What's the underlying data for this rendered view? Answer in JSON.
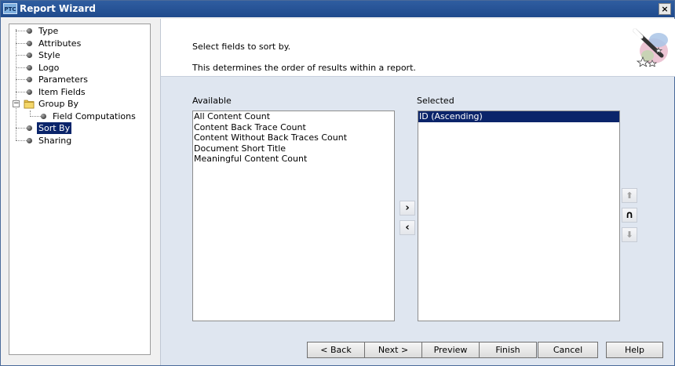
{
  "window": {
    "title": "Report Wizard",
    "logo_text": "PTC",
    "close_label": "×"
  },
  "tree": {
    "items": [
      {
        "label": "Type"
      },
      {
        "label": "Attributes"
      },
      {
        "label": "Style"
      },
      {
        "label": "Logo"
      },
      {
        "label": "Parameters"
      },
      {
        "label": "Item Fields"
      },
      {
        "label": "Group By",
        "expander": "−"
      },
      {
        "label": "Field Computations"
      },
      {
        "label": "Sort By",
        "selected": true
      },
      {
        "label": "Sharing"
      }
    ]
  },
  "header": {
    "instruction": "Select fields to sort by.",
    "description": "This determines the order of results within a report.",
    "icon": "wizard-wand-icon"
  },
  "available": {
    "label": "Available",
    "items": [
      "All Content Count",
      "Content Back Trace Count",
      "Content Without Back Traces Count",
      "Document Short Title",
      "Meaningful Content Count"
    ]
  },
  "selected": {
    "label": "Selected",
    "items": [
      "ID  (Ascending)"
    ]
  },
  "transfer": {
    "add": "›",
    "remove": "‹"
  },
  "ordering": {
    "up": "⬆",
    "toggle": "∩",
    "down": "⬇"
  },
  "buttons": {
    "back": "< Back",
    "next": "Next >",
    "preview": "Preview",
    "finish": "Finish",
    "cancel": "Cancel",
    "help": "Help"
  },
  "colors": {
    "selection": "#0a246a",
    "titlebar": "#2f5da0",
    "panel": "#dfe6f0"
  }
}
